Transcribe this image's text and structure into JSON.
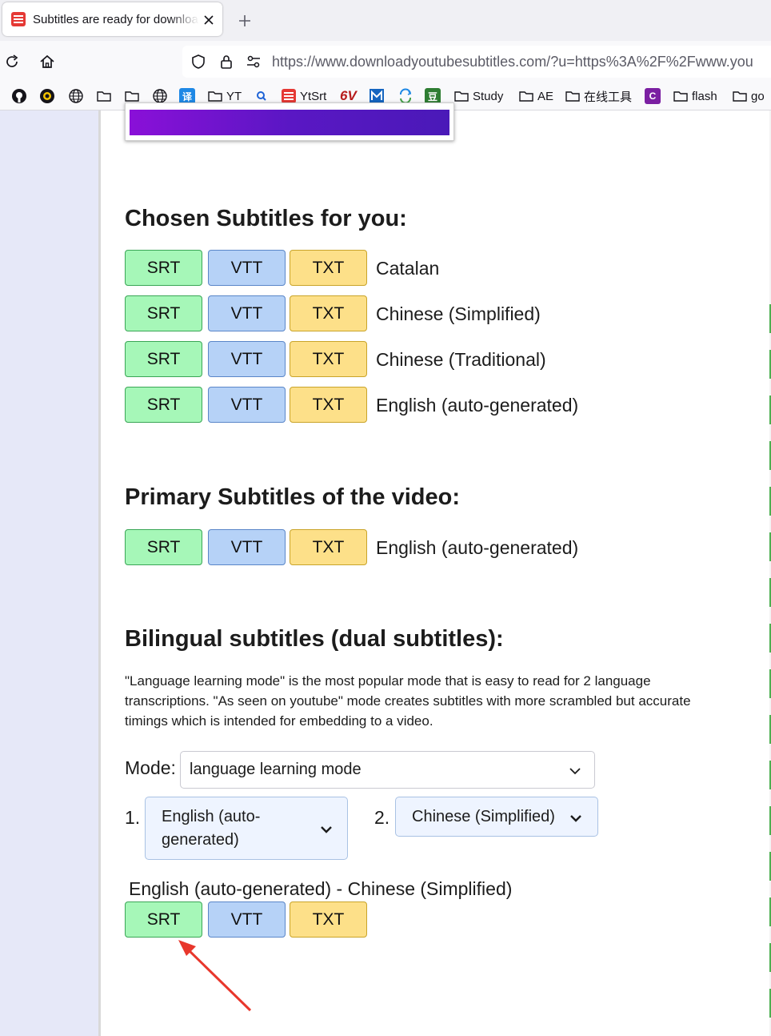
{
  "browser": {
    "tab_title": "Subtitles are ready for download",
    "new_tab_symbol": "+",
    "url": "https://www.downloadyoutubesubtitles.com/?u=https%3A%2F%2Fwww.you",
    "bookmarks": [
      "YT",
      "YtSrt",
      "6V",
      "Study",
      "AE",
      "在线工具",
      "flash",
      "go"
    ]
  },
  "sections": {
    "chosen_title": "Chosen Subtitles for you:",
    "primary_title": "Primary Subtitles of the video:",
    "bilingual_title": "Bilingual subtitles (dual subtitles):"
  },
  "buttons": {
    "srt": "SRT",
    "vtt": "VTT",
    "txt": "TXT"
  },
  "chosen_languages": [
    "Catalan",
    "Chinese (Simplified)",
    "Chinese (Traditional)",
    "English (auto-generated)"
  ],
  "primary_language": "English (auto-generated)",
  "bilingual": {
    "description": "\"Language learning mode\" is the most popular mode that is easy to read for 2 language transcriptions. \"As seen on youtube\" mode creates subtitles with more scrambled but accurate timings which is intended for embedding to a video.",
    "mode_label": "Mode:",
    "mode_value": "language learning mode",
    "lang1_num": "1.",
    "lang1_value": "English (auto-generated)",
    "lang2_num": "2.",
    "lang2_value": "Chinese (Simplified)",
    "pair_label": "English (auto-generated) - Chinese (Simplified)"
  },
  "colors": {
    "srt_bg": "#a6f7b8",
    "vtt_bg": "#b6d2f7",
    "txt_bg": "#fde089",
    "annotation_arrow": "#e8372c"
  }
}
